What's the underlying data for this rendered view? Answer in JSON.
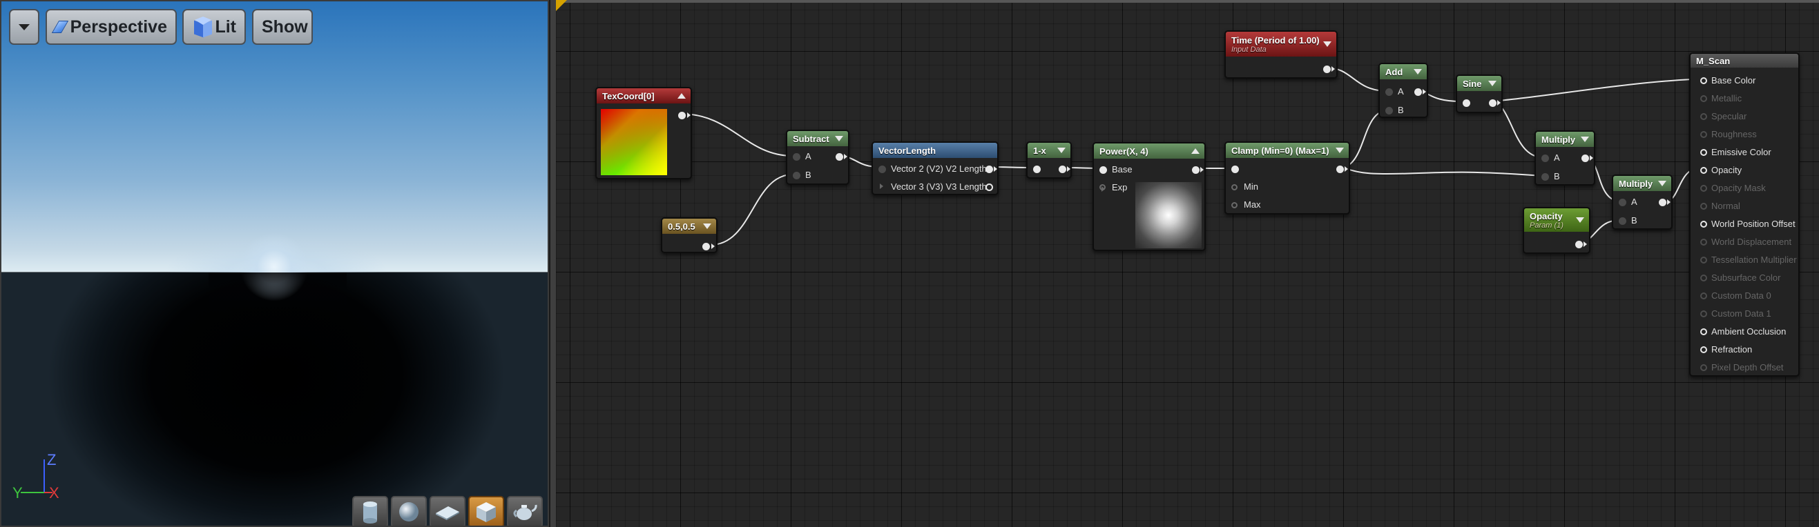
{
  "viewport": {
    "menu_icon": "chevron-down-icon",
    "perspective_label": "Perspective",
    "lit_label": "Lit",
    "show_label": "Show",
    "axis_labels": {
      "z": "Z",
      "y": "Y",
      "x": "X"
    },
    "preview_shapes": [
      {
        "name": "cylinder",
        "icon": "cylinder-icon",
        "active": false
      },
      {
        "name": "sphere",
        "icon": "sphere-icon",
        "active": false
      },
      {
        "name": "plane",
        "icon": "plane-icon",
        "active": false
      },
      {
        "name": "cube",
        "icon": "cube-icon",
        "active": true
      },
      {
        "name": "teapot",
        "icon": "teapot-icon",
        "active": false
      }
    ]
  },
  "graph": {
    "nodes": {
      "texcoord": {
        "title": "TexCoord[0]"
      },
      "constant": {
        "title": "0.5,0.5"
      },
      "subtract": {
        "title": "Subtract",
        "pin_a": "A",
        "pin_b": "B"
      },
      "vectorlength": {
        "title": "VectorLength",
        "out1": "Vector 2 (V2) V2 Length",
        "out2": "Vector 3 (V3) V3 Length"
      },
      "oneminus": {
        "title": "1-x"
      },
      "power": {
        "title": "Power(X, 4)",
        "pin_base": "Base",
        "pin_exp": "Exp"
      },
      "clamp": {
        "title": "Clamp (Min=0) (Max=1)",
        "pin_min": "Min",
        "pin_max": "Max"
      },
      "time": {
        "title": "Time (Period of 1.00)",
        "subtitle": "Input Data"
      },
      "add": {
        "title": "Add",
        "pin_a": "A",
        "pin_b": "B"
      },
      "sine": {
        "title": "Sine"
      },
      "multiply1": {
        "title": "Multiply",
        "pin_a": "A",
        "pin_b": "B"
      },
      "multiply2": {
        "title": "Multiply",
        "pin_a": "A",
        "pin_b": "B"
      },
      "opacity": {
        "title": "Opacity",
        "subtitle": "Param (1)"
      }
    },
    "result": {
      "title": "M_Scan",
      "inputs": [
        {
          "label": "Base Color",
          "enabled": true
        },
        {
          "label": "Metallic",
          "enabled": false
        },
        {
          "label": "Specular",
          "enabled": false
        },
        {
          "label": "Roughness",
          "enabled": false
        },
        {
          "label": "Emissive Color",
          "enabled": true
        },
        {
          "label": "Opacity",
          "enabled": true
        },
        {
          "label": "Opacity Mask",
          "enabled": false
        },
        {
          "label": "Normal",
          "enabled": false
        },
        {
          "label": "World Position Offset",
          "enabled": true
        },
        {
          "label": "World Displacement",
          "enabled": false
        },
        {
          "label": "Tessellation Multiplier",
          "enabled": false
        },
        {
          "label": "Subsurface Color",
          "enabled": false
        },
        {
          "label": "Custom Data 0",
          "enabled": false
        },
        {
          "label": "Custom Data 1",
          "enabled": false
        },
        {
          "label": "Ambient Occlusion",
          "enabled": true
        },
        {
          "label": "Refraction",
          "enabled": true
        },
        {
          "label": "Pixel Depth Offset",
          "enabled": false
        }
      ]
    }
  }
}
